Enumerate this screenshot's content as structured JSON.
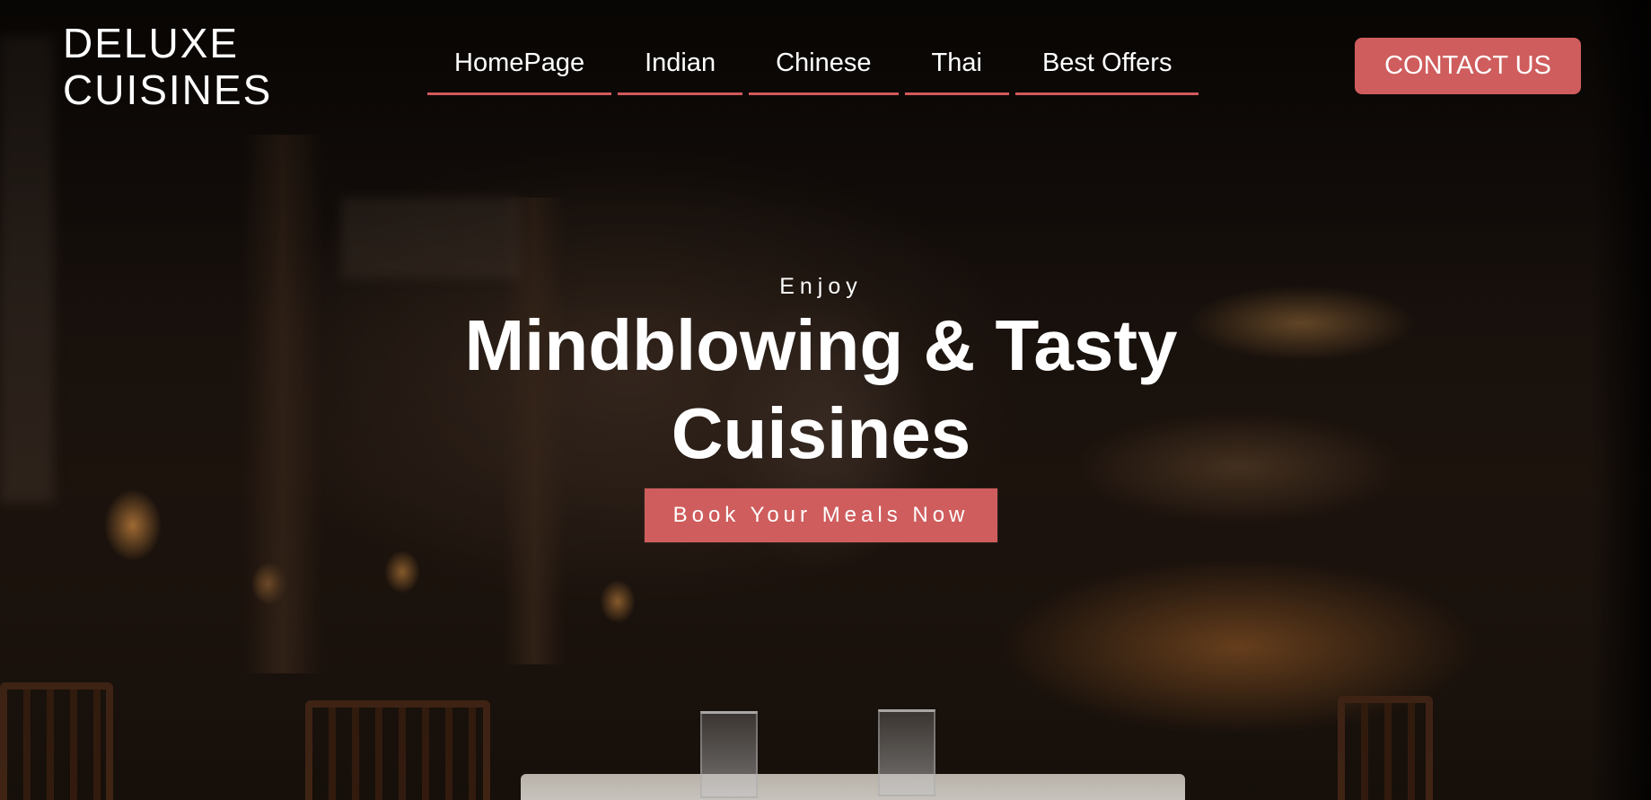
{
  "brand": {
    "line1": "DELUXE",
    "line2": "CUISINES"
  },
  "nav": {
    "items": [
      {
        "label": "HomePage"
      },
      {
        "label": "Indian"
      },
      {
        "label": "Chinese"
      },
      {
        "label": "Thai"
      },
      {
        "label": "Best Offers"
      }
    ]
  },
  "header": {
    "contact_label": "CONTACT US"
  },
  "hero": {
    "eyebrow": "Enjoy",
    "headline_line1": "Mindblowing & Tasty",
    "headline_line2": "Cuisines",
    "cta_label": "Book Your Meals Now",
    "background": "blurred-restaurant-interior-photo"
  },
  "colors": {
    "accent": "#cf5d5d",
    "text": "#ffffff"
  }
}
